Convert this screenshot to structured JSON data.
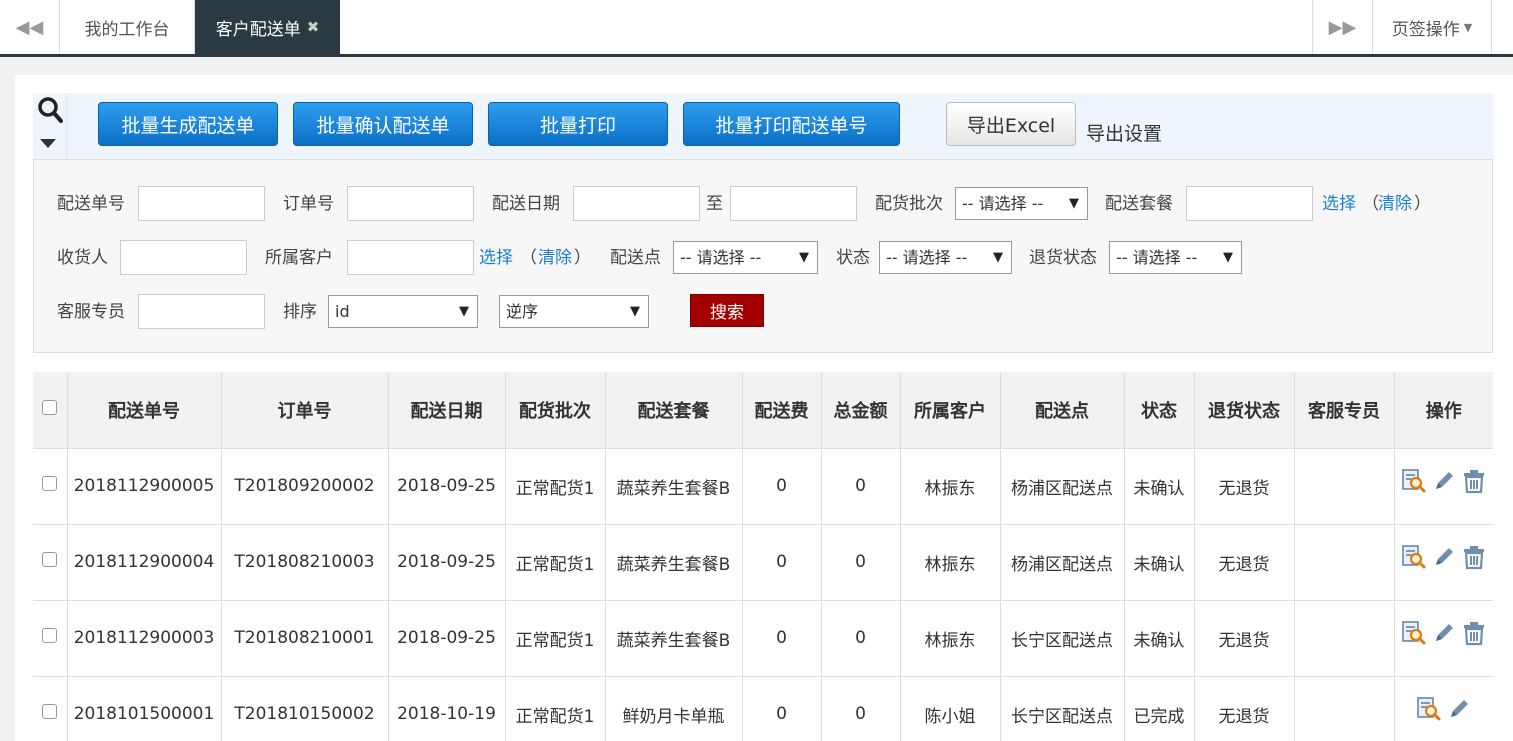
{
  "tabs": {
    "home": "我的工作台",
    "active": "客户配送单",
    "close": "✖",
    "prev": "◀◀",
    "next": "▶▶",
    "page_ops": "页签操作",
    "page_ops_caret": "▼"
  },
  "toolbar": {
    "batch_generate": "批量生成配送单",
    "batch_confirm": "批量确认配送单",
    "batch_print": "批量打印",
    "batch_print_no": "批量打印配送单号",
    "export_excel": "导出Excel",
    "export_settings": "导出设置"
  },
  "filters": {
    "delivery_no": "配送单号",
    "order_no": "订单号",
    "delivery_date": "配送日期",
    "to": "至",
    "batch": "配货批次",
    "batch_value": "-- 请选择 --",
    "package": "配送套餐",
    "select": "选择",
    "clear": "清除",
    "paren_open": "（",
    "paren_close": "）",
    "receiver": "收货人",
    "customer": "所属客户",
    "point": "配送点",
    "point_value": "-- 请选择 --",
    "status": "状态",
    "status_value": "-- 请选择 --",
    "return_status": "退货状态",
    "return_value": "-- 请选择 --",
    "service": "客服专员",
    "sort": "排序",
    "sort_field": "id",
    "sort_order": "逆序",
    "search": "搜索",
    "arrow": "▼"
  },
  "table": {
    "headers": [
      "配送单号",
      "订单号",
      "配送日期",
      "配货批次",
      "配送套餐",
      "配送费",
      "总金额",
      "所属客户",
      "配送点",
      "状态",
      "退货状态",
      "客服专员",
      "操作"
    ],
    "rows": [
      [
        "2018112900005",
        "T201809200002",
        "2018-09-25",
        "正常配货1",
        "蔬菜养生套餐B",
        "0",
        "0",
        "林振东",
        "杨浦区配送点",
        "未确认",
        "无退货",
        ""
      ],
      [
        "2018112900004",
        "T201808210003",
        "2018-09-25",
        "正常配货1",
        "蔬菜养生套餐B",
        "0",
        "0",
        "林振东",
        "杨浦区配送点",
        "未确认",
        "无退货",
        ""
      ],
      [
        "2018112900003",
        "T201808210001",
        "2018-09-25",
        "正常配货1",
        "蔬菜养生套餐B",
        "0",
        "0",
        "林振东",
        "长宁区配送点",
        "未确认",
        "无退货",
        ""
      ],
      [
        "2018101500001",
        "T201810150002",
        "2018-10-19",
        "正常配货1",
        "鲜奶月卡单瓶",
        "0",
        "0",
        "陈小姐",
        "长宁区配送点",
        "已完成",
        "无退货",
        ""
      ]
    ],
    "row_ops": [
      [
        "view-icon",
        "edit-icon",
        "delete-icon"
      ],
      [
        "view-icon",
        "edit-icon",
        "delete-icon"
      ],
      [
        "view-icon",
        "edit-icon",
        "delete-icon"
      ],
      [
        "view-icon",
        "edit-icon"
      ]
    ]
  },
  "colors": {
    "primary_button": "#1a85dd",
    "search_button": "#a50000",
    "active_tab": "#2b3a42",
    "link": "#1a7fd4"
  }
}
